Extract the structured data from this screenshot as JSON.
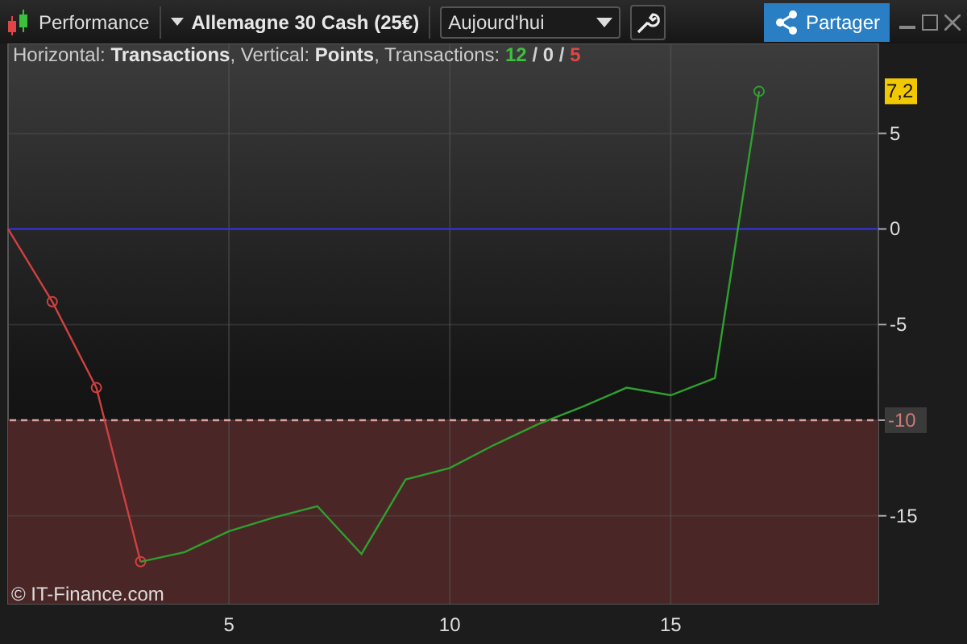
{
  "toolbar": {
    "title": "Performance",
    "instrument": "Allemagne 30 Cash (25€)",
    "period": "Aujourd'hui",
    "share": "Partager"
  },
  "header": {
    "text": "Horizontal: **Transactions**, Vertical: **Points**, Transactions:",
    "counts": [
      {
        "value": "12",
        "color": "#3cc13c"
      },
      {
        "value": "0",
        "color": "#d8d8d8"
      },
      {
        "value": "5",
        "color": "#e04545"
      }
    ],
    "separators": [
      "/",
      "/"
    ]
  },
  "copyright": "© IT-Finance.com",
  "chart": {
    "chart_data": {
      "type": "line",
      "x": [
        0,
        1,
        2,
        3,
        4,
        5,
        6,
        7,
        8,
        9,
        10,
        11,
        12,
        13,
        14,
        15,
        16,
        17
      ],
      "series": [
        {
          "color": "#d04040",
          "values": [
            0,
            -3.8,
            -8.3,
            -17.4,
            null,
            null,
            null,
            null,
            null,
            null,
            null,
            null,
            null,
            null,
            null,
            null,
            null,
            null
          ]
        },
        {
          "color": "#2fa02f",
          "values": [
            null,
            null,
            null,
            -17.4,
            -16.9,
            -15.8,
            -15.1,
            -14.5,
            -17,
            -13.1,
            -12.5,
            -11.3,
            -10.2,
            -9.3,
            -8.3,
            -8.7,
            -7.8,
            7.2
          ]
        }
      ],
      "xlim": [
        0,
        19.7
      ],
      "ylim": [
        -19.6,
        9.7
      ],
      "xticks": [
        5,
        10,
        15
      ],
      "yticks": [
        5,
        0,
        -5,
        -10,
        -15
      ],
      "grid": true,
      "ref_lines": [
        {
          "axis": "y",
          "value": 0,
          "color": "#3333cc"
        },
        {
          "axis": "y",
          "value": -10,
          "color": "#e0a0a0"
        }
      ],
      "annotations": [
        "7,2"
      ]
    }
  }
}
